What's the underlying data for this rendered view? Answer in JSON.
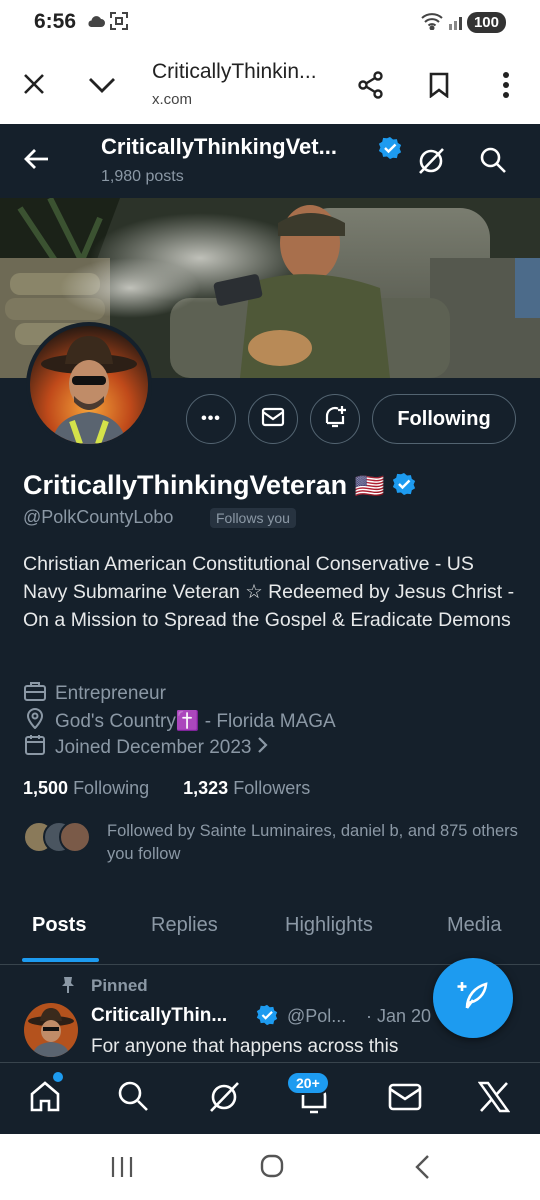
{
  "status_bar": {
    "time": "6:56",
    "battery": "100"
  },
  "browser": {
    "title": "CriticallyThinkin...",
    "url": "x.com"
  },
  "header": {
    "name": "CriticallyThinkingVet...",
    "posts": "1,980 posts"
  },
  "profile": {
    "display_name": "CriticallyThinkingVeteran",
    "flag": "🇺🇸",
    "handle": "@PolkCountyLobo",
    "follows_you": "Follows you",
    "bio": "Christian American Constitutional Conservative - US Navy Submarine Veteran ☆ Redeemed by Jesus Christ - On a Mission to Spread the Gospel & Eradicate Demons",
    "profession": "Entrepreneur",
    "location": "God's Country✝️ - Florida MAGA",
    "joined": "Joined December 2023",
    "following_count": "1,500",
    "following_label": "Following",
    "followers_count": "1,323",
    "followers_label": "Followers",
    "followed_by": "Followed by Sainte Luminaires, daniel b, and 875 others you follow"
  },
  "actions": {
    "following_button": "Following",
    "more": "•••"
  },
  "tabs": [
    {
      "label": "Posts"
    },
    {
      "label": "Replies"
    },
    {
      "label": "Highlights"
    },
    {
      "label": "Media"
    }
  ],
  "pinned_post": {
    "pinned_label": "Pinned",
    "author": "CriticallyThin...",
    "handle": "@Pol...",
    "date": "· Jan 20",
    "text": "For anyone that happens across this"
  },
  "bottom_nav": {
    "notifications_badge": "20+"
  },
  "colors": {
    "accent": "#1d9bf0",
    "background": "#15202b",
    "secondary_text": "#8b98a5"
  }
}
